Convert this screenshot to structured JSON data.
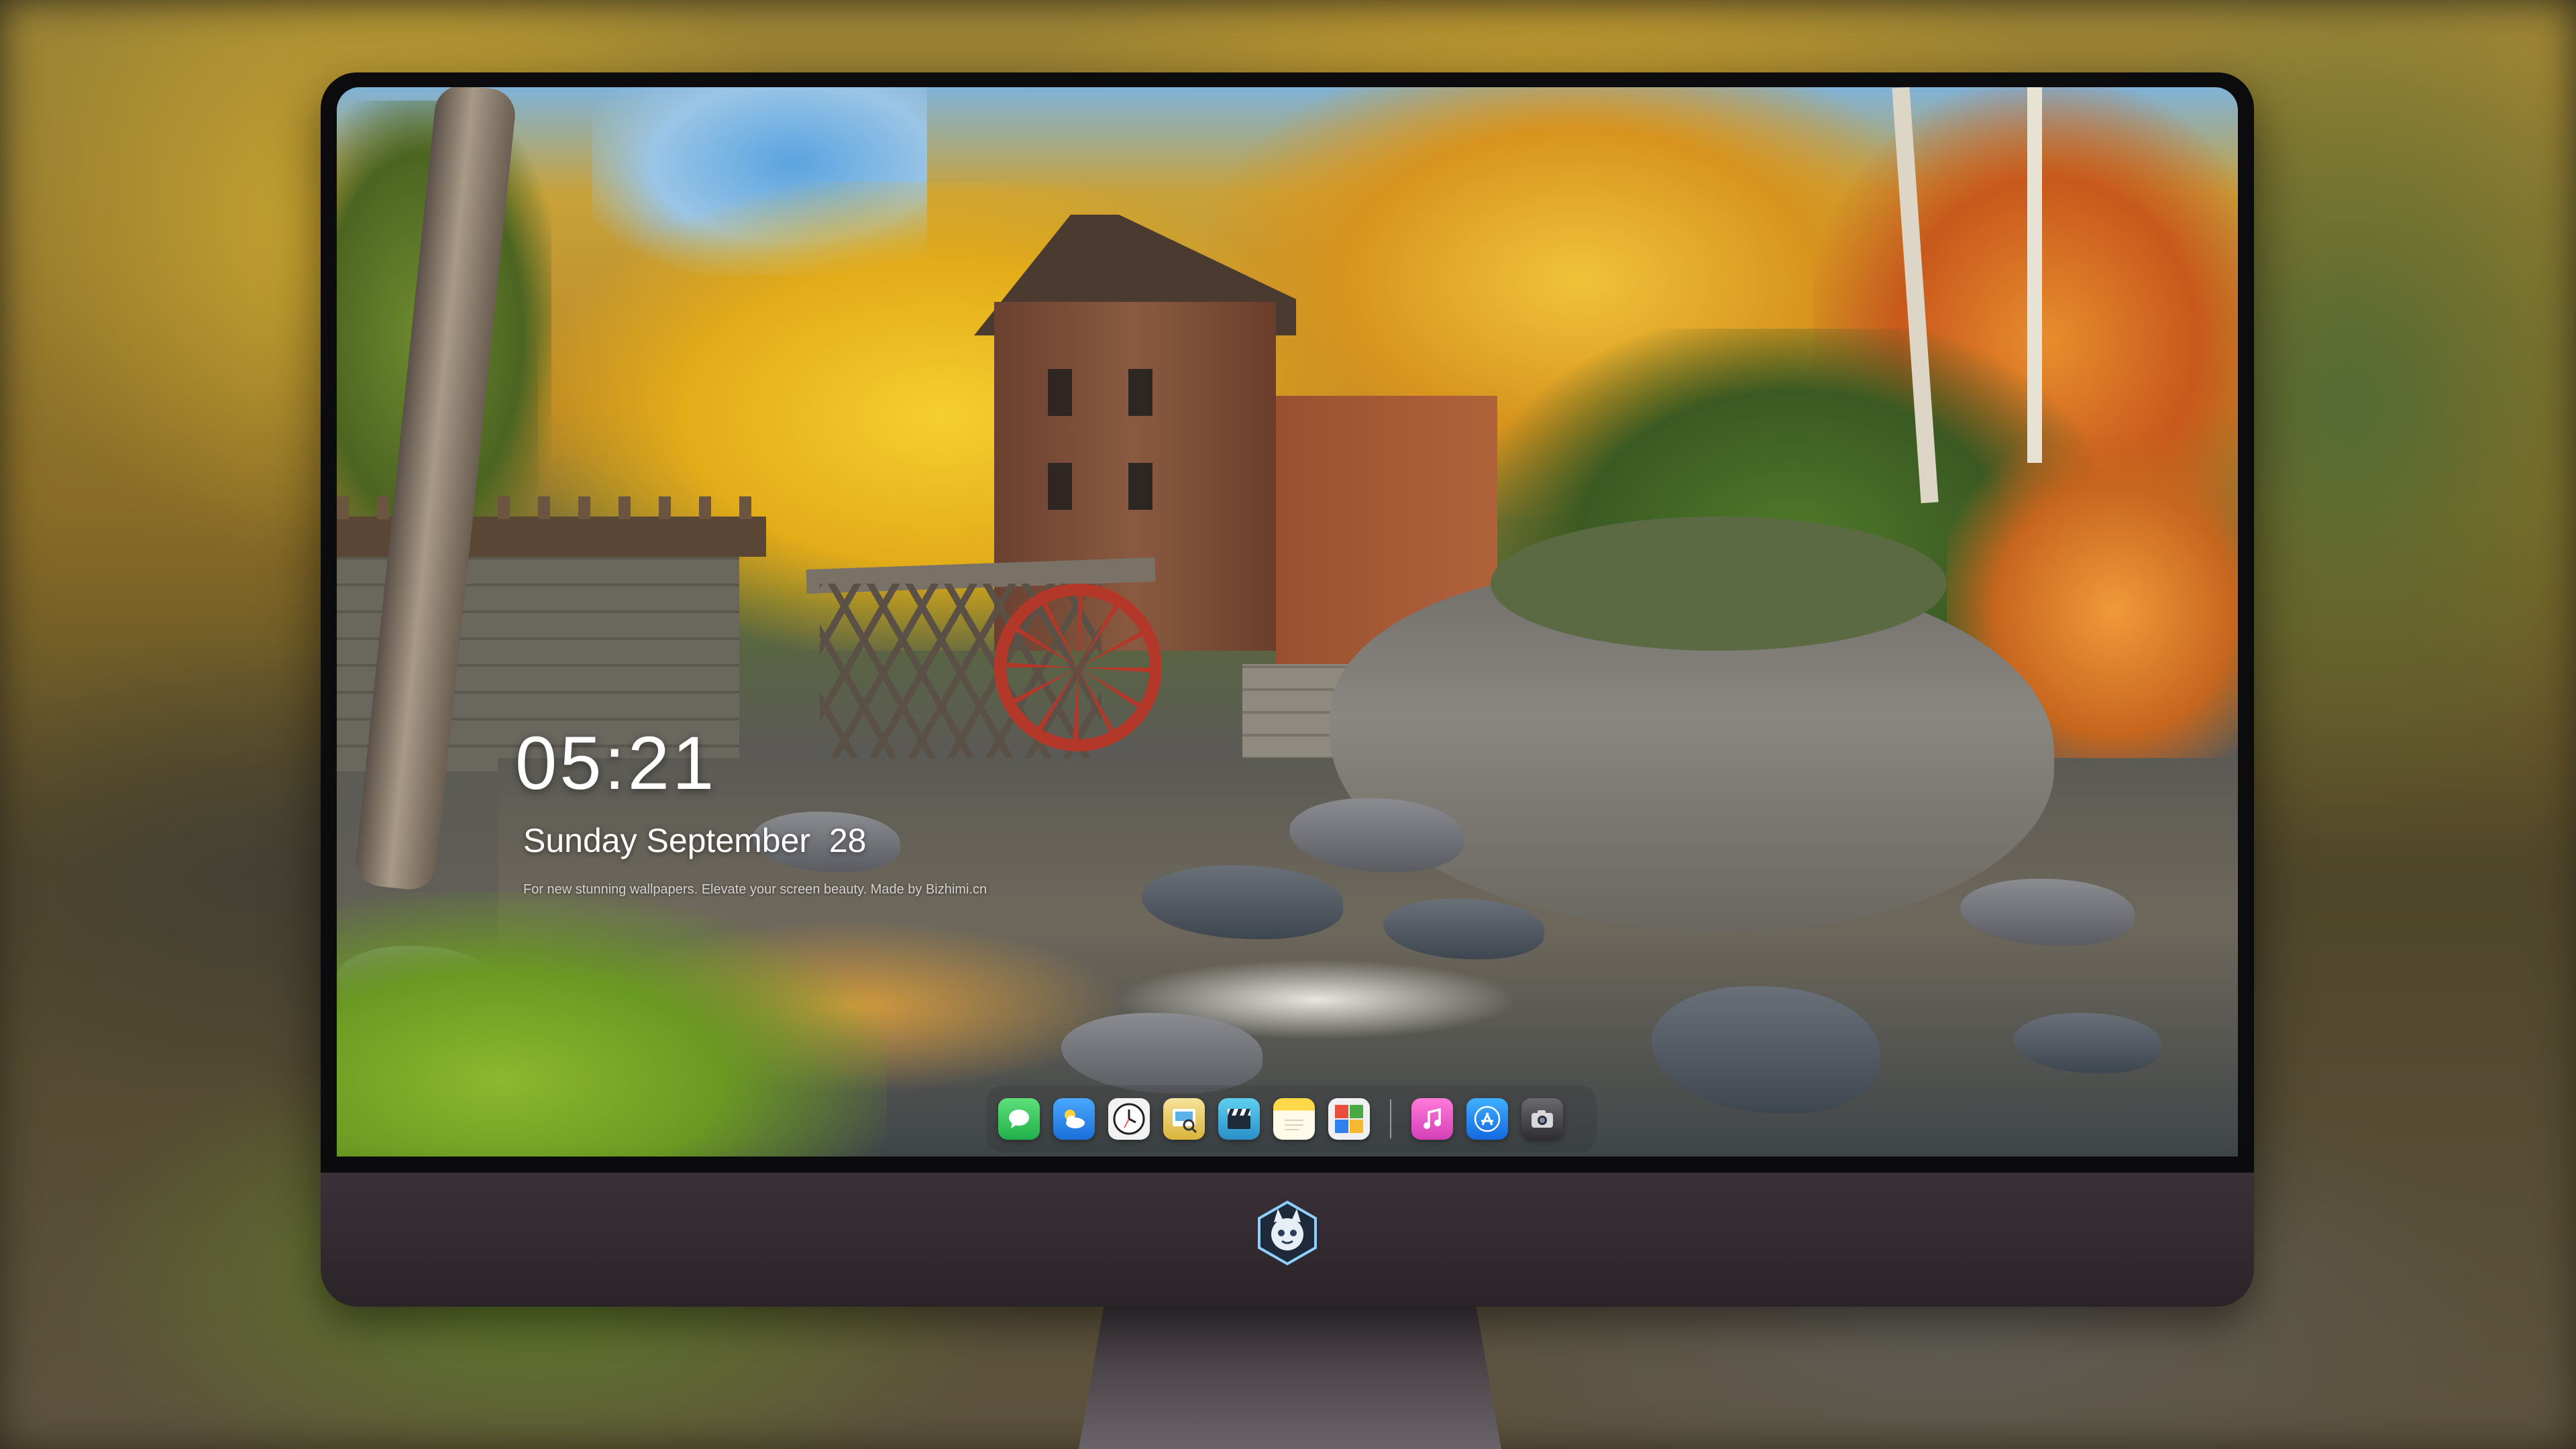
{
  "lockscreen": {
    "time": "05:21",
    "date": "Sunday September  28",
    "tagline": "For new stunning wallpapers. Elevate your screen beauty. Made by Bizhimi.cn"
  },
  "dock": {
    "apps": [
      {
        "name": "messages",
        "icon": "messages-icon",
        "color": "#34c759"
      },
      {
        "name": "weather",
        "icon": "weather-icon",
        "color": "#2f80ed"
      },
      {
        "name": "clock",
        "icon": "clock-icon",
        "color": "#f2f2f2"
      },
      {
        "name": "preview",
        "icon": "preview-icon",
        "color": "#e6c44a"
      },
      {
        "name": "video",
        "icon": "clapperboard-icon",
        "color": "#3fa9d6"
      },
      {
        "name": "notes",
        "icon": "notes-icon",
        "color": "#ffd84a"
      },
      {
        "name": "photo-booth",
        "icon": "photo-booth-icon",
        "color": "#49a942"
      },
      {
        "name": "music",
        "icon": "music-icon",
        "color": "#f35fd1"
      },
      {
        "name": "app-store",
        "icon": "app-store-icon",
        "color": "#1a8cff"
      },
      {
        "name": "camera",
        "icon": "camera-icon",
        "color": "#3a3a3c"
      }
    ]
  },
  "monitor": {
    "logo": "mascot-logo-icon",
    "bezel_color": "#0c0c0f",
    "chin_color": "#342c32"
  }
}
